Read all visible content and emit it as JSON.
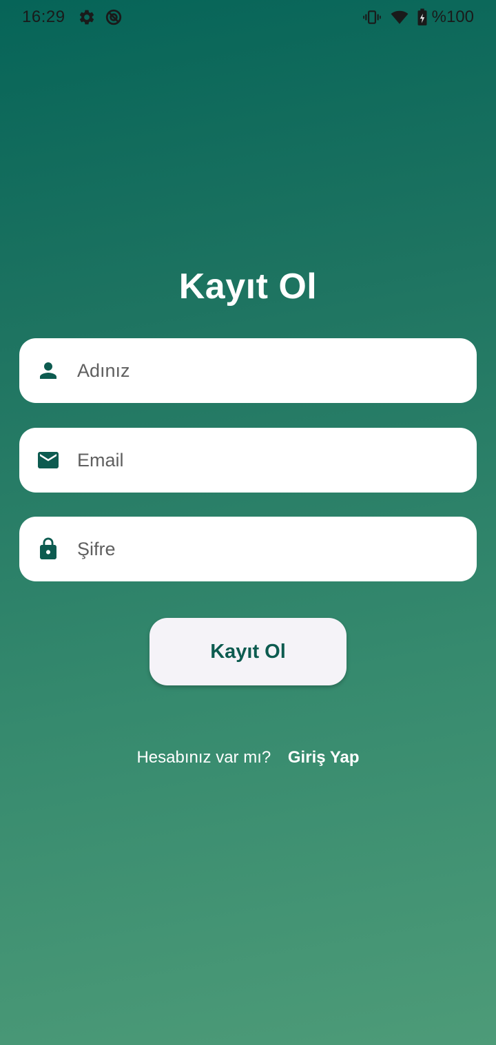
{
  "status_bar": {
    "time": "16:29",
    "battery_text": "%100",
    "icons": [
      "gear-icon",
      "data-saver-icon",
      "vibrate-icon",
      "wifi-icon",
      "battery-charging-icon"
    ]
  },
  "register": {
    "title": "Kayıt Ol",
    "name_field": {
      "placeholder": "Adınız",
      "value": "",
      "icon": "person-icon"
    },
    "email_field": {
      "placeholder": "Email",
      "value": "",
      "icon": "mail-icon"
    },
    "password_field": {
      "placeholder": "Şifre",
      "value": "",
      "icon": "lock-icon"
    },
    "submit_label": "Kayıt Ol"
  },
  "login_prompt": {
    "question": "Hesabınız var mı?",
    "link_label": "Giriş Yap"
  },
  "colors": {
    "gradient_top": "#066458",
    "gradient_bottom": "#4d9b78",
    "accent": "#0d5b50",
    "field_bg": "#ffffff",
    "button_bg": "#f5f3f8"
  }
}
